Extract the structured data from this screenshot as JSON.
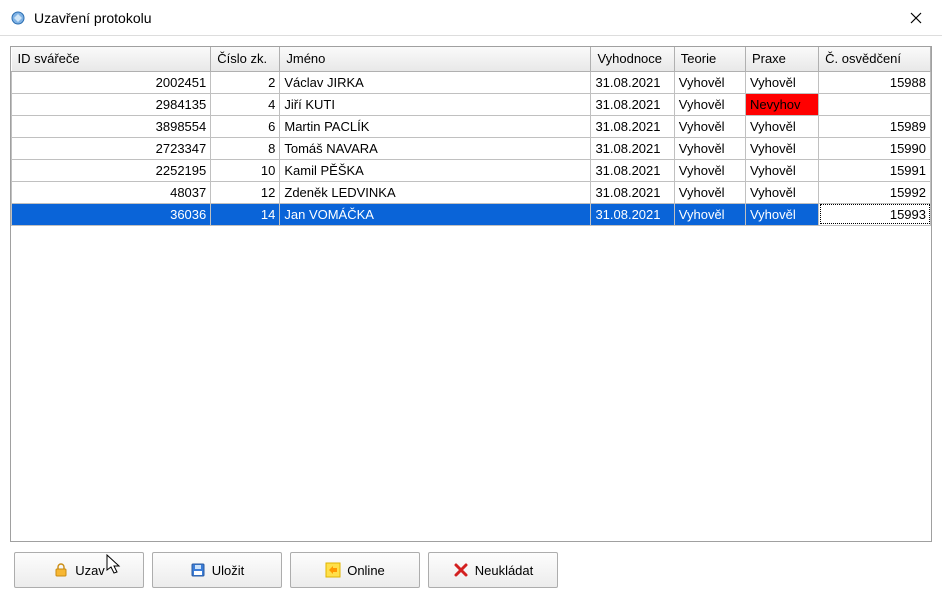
{
  "window": {
    "title": "Uzavření protokolu"
  },
  "table": {
    "columns": {
      "id": "ID svářeče",
      "num": "Číslo zk.",
      "name": "Jméno",
      "eval": "Vyhodnoce",
      "theory": "Teorie",
      "practice": "Praxe",
      "cert": "Č. osvědčení"
    },
    "rows": [
      {
        "id": "2002451",
        "num": "2",
        "name": "Václav JIRKA",
        "eval": "31.08.2021",
        "theory": "Vyhověl",
        "practice": "Vyhověl",
        "practice_fail": false,
        "cert": "15988"
      },
      {
        "id": "2984135",
        "num": "4",
        "name": "Jiří KUTI",
        "eval": "31.08.2021",
        "theory": "Vyhověl",
        "practice": "Nevyhov",
        "practice_fail": true,
        "cert": ""
      },
      {
        "id": "3898554",
        "num": "6",
        "name": "Martin PACLÍK",
        "eval": "31.08.2021",
        "theory": "Vyhověl",
        "practice": "Vyhověl",
        "practice_fail": false,
        "cert": "15989"
      },
      {
        "id": "2723347",
        "num": "8",
        "name": "Tomáš NAVARA",
        "eval": "31.08.2021",
        "theory": "Vyhověl",
        "practice": "Vyhověl",
        "practice_fail": false,
        "cert": "15990"
      },
      {
        "id": "2252195",
        "num": "10",
        "name": "Kamil PĚŠKA",
        "eval": "31.08.2021",
        "theory": "Vyhověl",
        "practice": "Vyhověl",
        "practice_fail": false,
        "cert": "15991"
      },
      {
        "id": "48037",
        "num": "12",
        "name": "Zdeněk LEDVINKA",
        "eval": "31.08.2021",
        "theory": "Vyhověl",
        "practice": "Vyhověl",
        "practice_fail": false,
        "cert": "15992"
      },
      {
        "id": "36036",
        "num": "14",
        "name": "Jan VOMÁČKA",
        "eval": "31.08.2021",
        "theory": "Vyhověl",
        "practice": "Vyhověl",
        "practice_fail": false,
        "cert": "15993",
        "selected": true
      }
    ]
  },
  "footer": {
    "close_lock": "Uzav",
    "save": "Uložit",
    "online": "Online",
    "nosave": "Neukládat"
  },
  "colors": {
    "selection": "#0a64d8",
    "fail": "#ff0000"
  }
}
